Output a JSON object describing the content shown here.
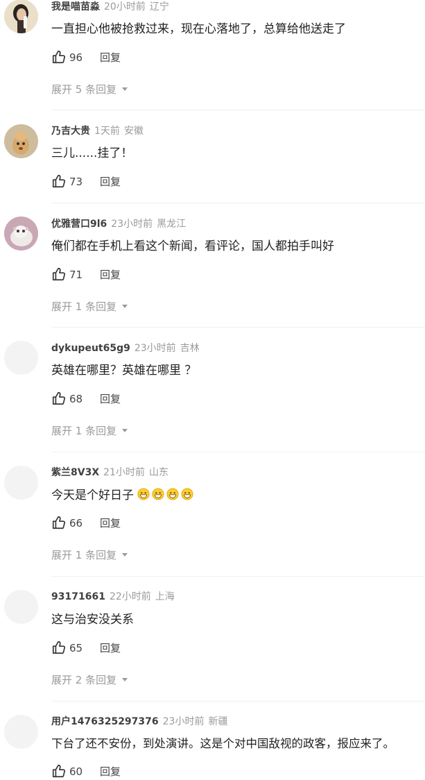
{
  "comments": [
    {
      "user": "我是喵苗淼",
      "time": "20小时前",
      "location": "辽宁",
      "text": "一直担心他被抢救过来，现在心落地了，总算给他送走了",
      "likes": "96",
      "reply": "回复",
      "expand": "展开 5 条回复",
      "avatar": "portrait-avatar"
    },
    {
      "user": "乃吉大贵",
      "time": "1天前",
      "location": "安徽",
      "text": "三儿......挂了！",
      "likes": "73",
      "reply": "回复",
      "avatar": "cartoon-dog-avatar"
    },
    {
      "user": "优雅营口9l6",
      "time": "23小时前",
      "location": "黑龙江",
      "text": "俺们都在手机上看这个新闻，看评论，国人都拍手叫好",
      "likes": "71",
      "reply": "回复",
      "expand": "展开 1 条回复",
      "avatar": "kitten-avatar"
    },
    {
      "user": "dykupeut65g9",
      "time": "23小时前",
      "location": "吉林",
      "text": "英雄在哪里？英雄在哪里 ？",
      "likes": "68",
      "reply": "回复",
      "expand": "展开 1 条回复",
      "avatar": "blank-avatar"
    },
    {
      "user": "紫兰8V3X",
      "time": "21小时前",
      "location": "山东",
      "text": "今天是个好日子",
      "likes": "66",
      "reply": "回复",
      "expand": "展开 1 条回复",
      "avatar": "blank-avatar",
      "emoji_icon": "grinning-face-icon"
    },
    {
      "user": "93171661",
      "time": "22小时前",
      "location": "上海",
      "text": "这与治安没关系",
      "likes": "65",
      "reply": "回复",
      "expand": "展开 2 条回复",
      "avatar": "blank-avatar"
    },
    {
      "user": "用户1476325297376",
      "time": "23小时前",
      "location": "新疆",
      "text": "下台了还不安份，到处演讲。这是个对中国敌视的政客，报应来了。",
      "likes": "60",
      "reply": "回复",
      "avatar": "blank-avatar"
    }
  ]
}
